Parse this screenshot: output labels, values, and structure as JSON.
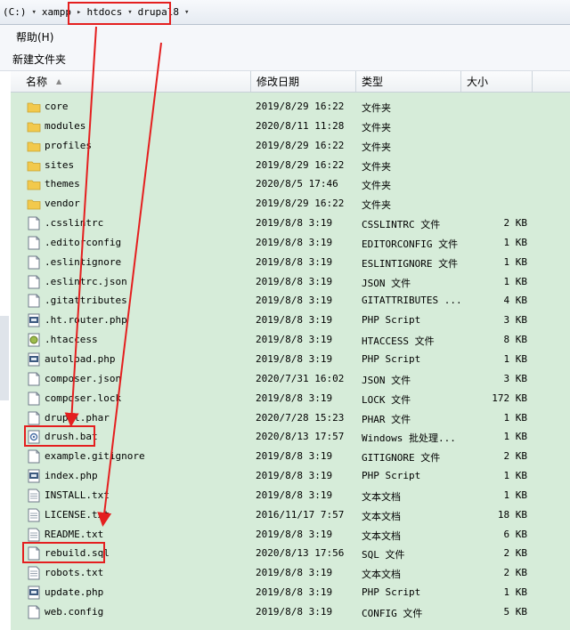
{
  "address_bar": {
    "crumbs": [
      "(C:)",
      "xampp",
      "htdocs",
      "drupal8"
    ]
  },
  "menu": {
    "help": "帮助(H)"
  },
  "toolbar": {
    "new_folder": "新建文件夹"
  },
  "columns": {
    "name": "名称",
    "date": "修改日期",
    "type": "类型",
    "size": "大小"
  },
  "files": [
    {
      "name": "core",
      "date": "2019/8/29 16:22",
      "type": "文件夹",
      "size": "",
      "icon": "folder-icon"
    },
    {
      "name": "modules",
      "date": "2020/8/11 11:28",
      "type": "文件夹",
      "size": "",
      "icon": "folder-icon"
    },
    {
      "name": "profiles",
      "date": "2019/8/29 16:22",
      "type": "文件夹",
      "size": "",
      "icon": "folder-icon"
    },
    {
      "name": "sites",
      "date": "2019/8/29 16:22",
      "type": "文件夹",
      "size": "",
      "icon": "folder-icon"
    },
    {
      "name": "themes",
      "date": "2020/8/5 17:46",
      "type": "文件夹",
      "size": "",
      "icon": "folder-icon"
    },
    {
      "name": "vendor",
      "date": "2019/8/29 16:22",
      "type": "文件夹",
      "size": "",
      "icon": "folder-icon"
    },
    {
      "name": ".csslintrc",
      "date": "2019/8/8 3:19",
      "type": "CSSLINTRC 文件",
      "size": "2 KB",
      "icon": "file-icon"
    },
    {
      "name": ".editorconfig",
      "date": "2019/8/8 3:19",
      "type": "EDITORCONFIG 文件",
      "size": "1 KB",
      "icon": "file-icon"
    },
    {
      "name": ".eslintignore",
      "date": "2019/8/8 3:19",
      "type": "ESLINTIGNORE 文件",
      "size": "1 KB",
      "icon": "file-icon"
    },
    {
      "name": ".eslintrc.json",
      "date": "2019/8/8 3:19",
      "type": "JSON 文件",
      "size": "1 KB",
      "icon": "file-icon"
    },
    {
      "name": ".gitattributes",
      "date": "2019/8/8 3:19",
      "type": "GITATTRIBUTES ...",
      "size": "4 KB",
      "icon": "file-icon"
    },
    {
      "name": ".ht.router.php",
      "date": "2019/8/8 3:19",
      "type": "PHP Script",
      "size": "3 KB",
      "icon": "php-icon"
    },
    {
      "name": ".htaccess",
      "date": "2019/8/8 3:19",
      "type": "HTACCESS 文件",
      "size": "8 KB",
      "icon": "htaccess-icon"
    },
    {
      "name": "autoload.php",
      "date": "2019/8/8 3:19",
      "type": "PHP Script",
      "size": "1 KB",
      "icon": "php-icon"
    },
    {
      "name": "composer.json",
      "date": "2020/7/31 16:02",
      "type": "JSON 文件",
      "size": "3 KB",
      "icon": "file-icon"
    },
    {
      "name": "composer.lock",
      "date": "2019/8/8 3:19",
      "type": "LOCK 文件",
      "size": "172 KB",
      "icon": "file-icon"
    },
    {
      "name": "drupal.phar",
      "date": "2020/7/28 15:23",
      "type": "PHAR 文件",
      "size": "1 KB",
      "icon": "file-icon"
    },
    {
      "name": "drush.bat",
      "date": "2020/8/13 17:57",
      "type": "Windows 批处理...",
      "size": "1 KB",
      "icon": "bat-icon"
    },
    {
      "name": "example.gitignore",
      "date": "2019/8/8 3:19",
      "type": "GITIGNORE 文件",
      "size": "2 KB",
      "icon": "file-icon"
    },
    {
      "name": "index.php",
      "date": "2019/8/8 3:19",
      "type": "PHP Script",
      "size": "1 KB",
      "icon": "php-icon"
    },
    {
      "name": "INSTALL.txt",
      "date": "2019/8/8 3:19",
      "type": "文本文档",
      "size": "1 KB",
      "icon": "text-file-icon"
    },
    {
      "name": "LICENSE.txt",
      "date": "2016/11/17 7:57",
      "type": "文本文档",
      "size": "18 KB",
      "icon": "text-file-icon"
    },
    {
      "name": "README.txt",
      "date": "2019/8/8 3:19",
      "type": "文本文档",
      "size": "6 KB",
      "icon": "text-file-icon"
    },
    {
      "name": "rebuild.sql",
      "date": "2020/8/13 17:56",
      "type": "SQL 文件",
      "size": "2 KB",
      "icon": "file-icon"
    },
    {
      "name": "robots.txt",
      "date": "2019/8/8 3:19",
      "type": "文本文档",
      "size": "2 KB",
      "icon": "text-file-icon"
    },
    {
      "name": "update.php",
      "date": "2019/8/8 3:19",
      "type": "PHP Script",
      "size": "1 KB",
      "icon": "php-icon"
    },
    {
      "name": "web.config",
      "date": "2019/8/8 3:19",
      "type": "CONFIG 文件",
      "size": "5 KB",
      "icon": "file-icon"
    }
  ],
  "colors": {
    "annotation": "#e41f1f",
    "pane": "#d6ecd9",
    "folder": "#f2c94c"
  }
}
